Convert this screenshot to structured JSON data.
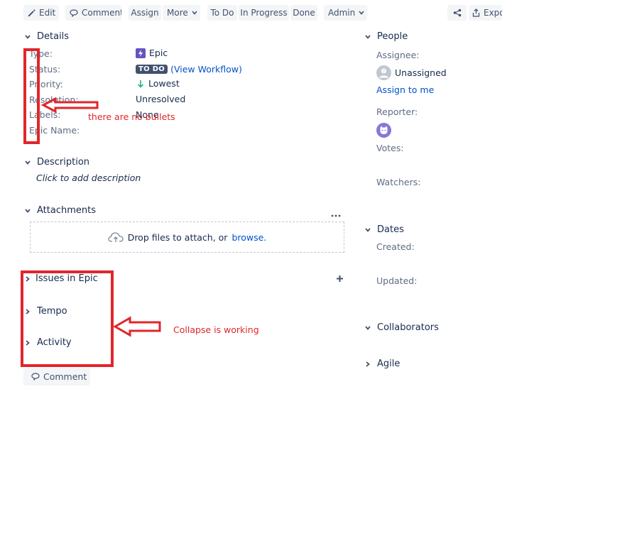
{
  "toolbar": {
    "edit": "Edit",
    "comment": "Comment",
    "assign": "Assign",
    "more": "More",
    "todo": "To Do",
    "in_progress": "In Progress",
    "done": "Done",
    "admin": "Admin",
    "export": "Expo"
  },
  "details": {
    "title": "Details",
    "fields": {
      "type_label": "Type:",
      "type_value": "Epic",
      "status_label": "Status:",
      "status_value": "TO DO",
      "status_link": "(View Workflow)",
      "priority_label": "Priority:",
      "priority_value": "Lowest",
      "resolution_label": "Resolution:",
      "resolution_value": "Unresolved",
      "labels_label": "Labels:",
      "labels_value": "None",
      "epic_name_label": "Epic Name:"
    }
  },
  "description": {
    "title": "Description",
    "placeholder": "Click to add description"
  },
  "attachments": {
    "title": "Attachments",
    "drop_text": "Drop files to attach, or",
    "browse": "browse."
  },
  "collapsed_sections": {
    "issues_in_epic": "Issues in Epic",
    "tempo": "Tempo",
    "activity": "Activity"
  },
  "comment_button": "Comment",
  "people": {
    "title": "People",
    "assignee_label": "Assignee:",
    "assignee_value": "Unassigned",
    "assign_to_me": "Assign to me",
    "reporter_label": "Reporter:",
    "votes_label": "Votes:",
    "watchers_label": "Watchers:"
  },
  "dates": {
    "title": "Dates",
    "created_label": "Created:",
    "updated_label": "Updated:"
  },
  "collaborators": {
    "title": "Collaborators"
  },
  "agile": {
    "title": "Agile"
  },
  "annotations": {
    "no_bullets": "there are no bullets",
    "collapse_working": "Collapse is working"
  },
  "colors": {
    "annotation_red": "#e0262b",
    "link_blue": "#0052cc",
    "epic_purple": "#6554c0",
    "priority_green": "#36b37e"
  }
}
